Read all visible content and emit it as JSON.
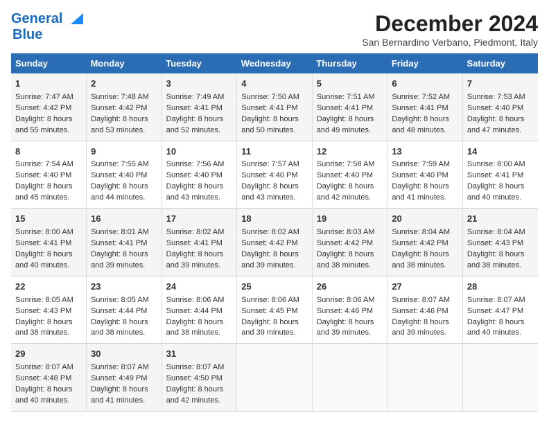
{
  "header": {
    "logo_line1": "General",
    "logo_line2": "Blue",
    "title": "December 2024",
    "subtitle": "San Bernardino Verbano, Piedmont, Italy"
  },
  "calendar": {
    "weekdays": [
      "Sunday",
      "Monday",
      "Tuesday",
      "Wednesday",
      "Thursday",
      "Friday",
      "Saturday"
    ],
    "weeks": [
      [
        {
          "day": "1",
          "rise": "Sunrise: 7:47 AM",
          "set": "Sunset: 4:42 PM",
          "light": "Daylight: 8 hours and 55 minutes."
        },
        {
          "day": "2",
          "rise": "Sunrise: 7:48 AM",
          "set": "Sunset: 4:42 PM",
          "light": "Daylight: 8 hours and 53 minutes."
        },
        {
          "day": "3",
          "rise": "Sunrise: 7:49 AM",
          "set": "Sunset: 4:41 PM",
          "light": "Daylight: 8 hours and 52 minutes."
        },
        {
          "day": "4",
          "rise": "Sunrise: 7:50 AM",
          "set": "Sunset: 4:41 PM",
          "light": "Daylight: 8 hours and 50 minutes."
        },
        {
          "day": "5",
          "rise": "Sunrise: 7:51 AM",
          "set": "Sunset: 4:41 PM",
          "light": "Daylight: 8 hours and 49 minutes."
        },
        {
          "day": "6",
          "rise": "Sunrise: 7:52 AM",
          "set": "Sunset: 4:41 PM",
          "light": "Daylight: 8 hours and 48 minutes."
        },
        {
          "day": "7",
          "rise": "Sunrise: 7:53 AM",
          "set": "Sunset: 4:40 PM",
          "light": "Daylight: 8 hours and 47 minutes."
        }
      ],
      [
        {
          "day": "8",
          "rise": "Sunrise: 7:54 AM",
          "set": "Sunset: 4:40 PM",
          "light": "Daylight: 8 hours and 45 minutes."
        },
        {
          "day": "9",
          "rise": "Sunrise: 7:55 AM",
          "set": "Sunset: 4:40 PM",
          "light": "Daylight: 8 hours and 44 minutes."
        },
        {
          "day": "10",
          "rise": "Sunrise: 7:56 AM",
          "set": "Sunset: 4:40 PM",
          "light": "Daylight: 8 hours and 43 minutes."
        },
        {
          "day": "11",
          "rise": "Sunrise: 7:57 AM",
          "set": "Sunset: 4:40 PM",
          "light": "Daylight: 8 hours and 43 minutes."
        },
        {
          "day": "12",
          "rise": "Sunrise: 7:58 AM",
          "set": "Sunset: 4:40 PM",
          "light": "Daylight: 8 hours and 42 minutes."
        },
        {
          "day": "13",
          "rise": "Sunrise: 7:59 AM",
          "set": "Sunset: 4:40 PM",
          "light": "Daylight: 8 hours and 41 minutes."
        },
        {
          "day": "14",
          "rise": "Sunrise: 8:00 AM",
          "set": "Sunset: 4:41 PM",
          "light": "Daylight: 8 hours and 40 minutes."
        }
      ],
      [
        {
          "day": "15",
          "rise": "Sunrise: 8:00 AM",
          "set": "Sunset: 4:41 PM",
          "light": "Daylight: 8 hours and 40 minutes."
        },
        {
          "day": "16",
          "rise": "Sunrise: 8:01 AM",
          "set": "Sunset: 4:41 PM",
          "light": "Daylight: 8 hours and 39 minutes."
        },
        {
          "day": "17",
          "rise": "Sunrise: 8:02 AM",
          "set": "Sunset: 4:41 PM",
          "light": "Daylight: 8 hours and 39 minutes."
        },
        {
          "day": "18",
          "rise": "Sunrise: 8:02 AM",
          "set": "Sunset: 4:42 PM",
          "light": "Daylight: 8 hours and 39 minutes."
        },
        {
          "day": "19",
          "rise": "Sunrise: 8:03 AM",
          "set": "Sunset: 4:42 PM",
          "light": "Daylight: 8 hours and 38 minutes."
        },
        {
          "day": "20",
          "rise": "Sunrise: 8:04 AM",
          "set": "Sunset: 4:42 PM",
          "light": "Daylight: 8 hours and 38 minutes."
        },
        {
          "day": "21",
          "rise": "Sunrise: 8:04 AM",
          "set": "Sunset: 4:43 PM",
          "light": "Daylight: 8 hours and 38 minutes."
        }
      ],
      [
        {
          "day": "22",
          "rise": "Sunrise: 8:05 AM",
          "set": "Sunset: 4:43 PM",
          "light": "Daylight: 8 hours and 38 minutes."
        },
        {
          "day": "23",
          "rise": "Sunrise: 8:05 AM",
          "set": "Sunset: 4:44 PM",
          "light": "Daylight: 8 hours and 38 minutes."
        },
        {
          "day": "24",
          "rise": "Sunrise: 8:06 AM",
          "set": "Sunset: 4:44 PM",
          "light": "Daylight: 8 hours and 38 minutes."
        },
        {
          "day": "25",
          "rise": "Sunrise: 8:06 AM",
          "set": "Sunset: 4:45 PM",
          "light": "Daylight: 8 hours and 39 minutes."
        },
        {
          "day": "26",
          "rise": "Sunrise: 8:06 AM",
          "set": "Sunset: 4:46 PM",
          "light": "Daylight: 8 hours and 39 minutes."
        },
        {
          "day": "27",
          "rise": "Sunrise: 8:07 AM",
          "set": "Sunset: 4:46 PM",
          "light": "Daylight: 8 hours and 39 minutes."
        },
        {
          "day": "28",
          "rise": "Sunrise: 8:07 AM",
          "set": "Sunset: 4:47 PM",
          "light": "Daylight: 8 hours and 40 minutes."
        }
      ],
      [
        {
          "day": "29",
          "rise": "Sunrise: 8:07 AM",
          "set": "Sunset: 4:48 PM",
          "light": "Daylight: 8 hours and 40 minutes."
        },
        {
          "day": "30",
          "rise": "Sunrise: 8:07 AM",
          "set": "Sunset: 4:49 PM",
          "light": "Daylight: 8 hours and 41 minutes."
        },
        {
          "day": "31",
          "rise": "Sunrise: 8:07 AM",
          "set": "Sunset: 4:50 PM",
          "light": "Daylight: 8 hours and 42 minutes."
        },
        null,
        null,
        null,
        null
      ]
    ]
  }
}
